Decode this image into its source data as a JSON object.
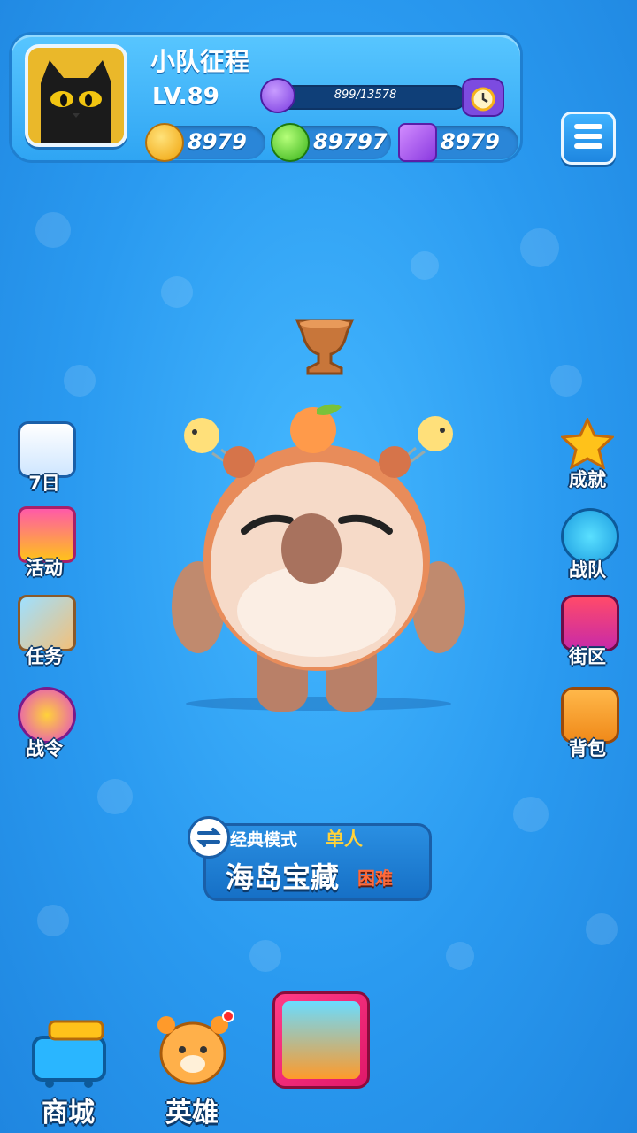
{
  "profile": {
    "name": "小队征程",
    "level": "LV.89",
    "xp_text": "899/13578",
    "xp_progress": 0.066
  },
  "currencies": [
    {
      "icon": "gold-coin-icon",
      "value": "8979"
    },
    {
      "icon": "green-gem-icon",
      "value": "89797"
    },
    {
      "icon": "purple-ticket-icon",
      "value": "8979"
    }
  ],
  "left_menu": [
    {
      "label": "7日",
      "icon": "calendar-icon"
    },
    {
      "label": "活动",
      "icon": "gift-box-icon"
    },
    {
      "label": "任务",
      "icon": "quest-scroll-icon"
    },
    {
      "label": "战令",
      "icon": "battle-pass-icon"
    }
  ],
  "right_menu": [
    {
      "label": "成就",
      "icon": "star-icon"
    },
    {
      "label": "战队",
      "icon": "team-icon"
    },
    {
      "label": "街区",
      "icon": "map-pin-icon"
    },
    {
      "label": "背包",
      "icon": "backpack-icon"
    }
  ],
  "mode": {
    "type": "经典模式",
    "players": "单人",
    "map": "海岛宝藏",
    "difficulty": "困难"
  },
  "bottom_nav": [
    {
      "label": "商城",
      "icon": "shop-cart-icon"
    },
    {
      "label": "英雄",
      "icon": "tiger-hero-icon"
    }
  ],
  "colors": {
    "background": "#2a9af0",
    "xp_fill": "#e642d8",
    "accent_yellow": "#ffd23a",
    "difficulty_red": "#ff6a3a"
  }
}
